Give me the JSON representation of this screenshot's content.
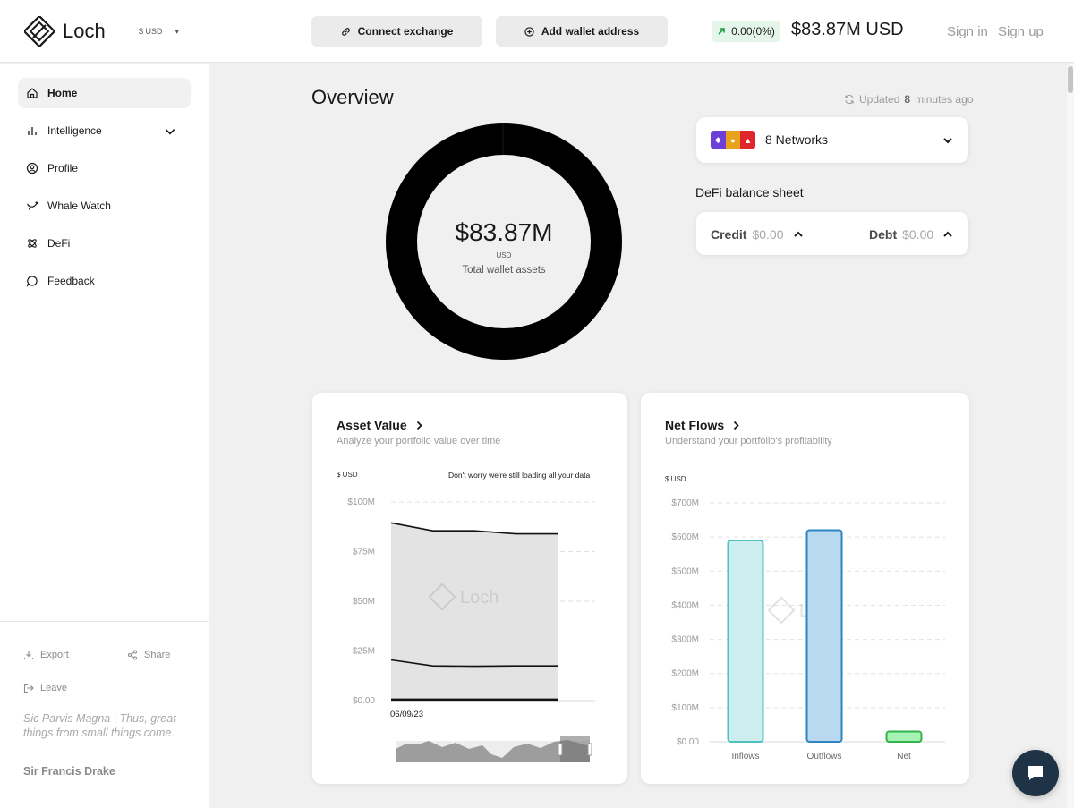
{
  "header": {
    "logo_text": "Loch",
    "currency": "$ USD",
    "connect_exchange": "Connect exchange",
    "add_wallet": "Add wallet address",
    "change": "0.00(0%)",
    "total": "$83.87M USD",
    "sign_in": "Sign in",
    "sign_up": "Sign up"
  },
  "sidebar": {
    "items": [
      {
        "label": "Home",
        "icon": "home-icon"
      },
      {
        "label": "Intelligence",
        "icon": "bar-chart-icon"
      },
      {
        "label": "Profile",
        "icon": "user-icon"
      },
      {
        "label": "Whale Watch",
        "icon": "whale-icon"
      },
      {
        "label": "DeFi",
        "icon": "atom-icon"
      },
      {
        "label": "Feedback",
        "icon": "chat-icon"
      }
    ],
    "export": "Export",
    "share": "Share",
    "leave": "Leave",
    "quote": "Sic Parvis Magna | Thus, great things from small things come.",
    "quote_author": "Sir Francis Drake"
  },
  "overview": {
    "title": "Overview",
    "updated_prefix": "Updated",
    "updated_value": "8",
    "updated_suffix": "minutes ago",
    "total_value": "$83.87M",
    "total_unit": "USD",
    "total_label": "Total wallet assets"
  },
  "networks": {
    "label": "8 Networks",
    "colors": [
      "#6c3fd6",
      "#e8a21c",
      "#e0262d"
    ]
  },
  "defi": {
    "title": "DeFi balance sheet",
    "credit_label": "Credit",
    "credit_value": "$0.00",
    "debt_label": "Debt",
    "debt_value": "$0.00"
  },
  "asset_value": {
    "title": "Asset Value",
    "subtitle": "Analyze your portfolio value over time",
    "unit": "$ USD",
    "loading_note": "Don't worry we're still loading all your data",
    "watermark": "Loch"
  },
  "net_flows": {
    "title": "Net Flows",
    "subtitle": "Understand your portfolio's profitability",
    "unit": "$ USD",
    "watermark": "Loch"
  },
  "chart_data": [
    {
      "type": "area",
      "ylim": [
        0,
        100
      ],
      "yticks": [
        "$0.00",
        "$25M",
        "$50M",
        "$75M",
        "$100M"
      ],
      "x": [
        "06/09/23"
      ],
      "series": [
        {
          "values": [
            89.5,
            85.5,
            85.5,
            84,
            84
          ]
        },
        {
          "values": [
            20.5,
            17.5,
            17.3,
            17.5,
            17.5
          ]
        },
        {
          "values": [
            0.5,
            0.5,
            0.5,
            0.5,
            0.5
          ]
        }
      ]
    },
    {
      "type": "bar",
      "categories": [
        "Inflows",
        "Outflows",
        "Net"
      ],
      "values": [
        590,
        620,
        30
      ],
      "ylim": [
        0,
        700
      ],
      "yticks": [
        "$0.00",
        "$100M",
        "$200M",
        "$300M",
        "$400M",
        "$500M",
        "$600M",
        "$700M"
      ],
      "colors": [
        {
          "fill": "#cdeeee",
          "stroke": "#4fbfc0"
        },
        {
          "fill": "#b8d9ef",
          "stroke": "#2e86c1"
        },
        {
          "fill": "#a6f1b4",
          "stroke": "#2fb34a"
        }
      ]
    }
  ]
}
